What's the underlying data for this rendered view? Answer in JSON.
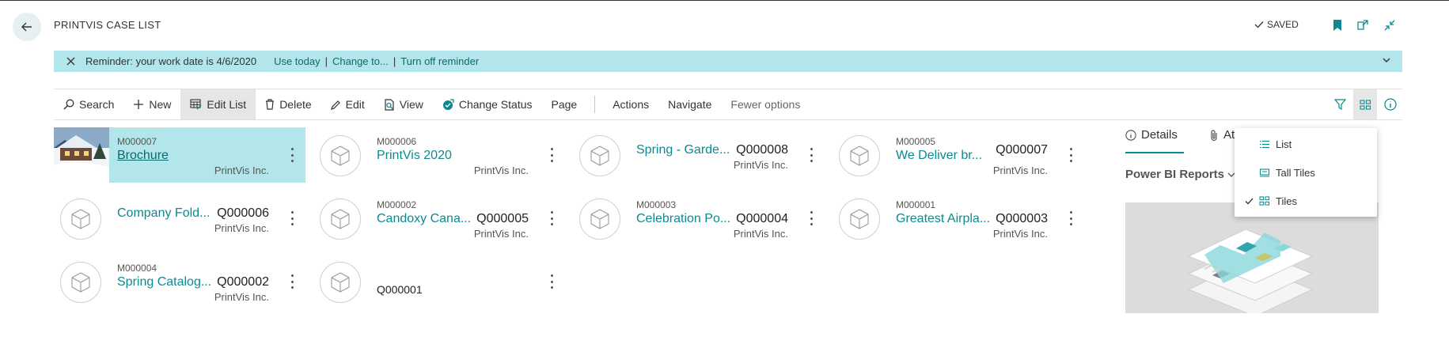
{
  "header": {
    "title": "PRINTVIS CASE LIST",
    "saved_label": "SAVED"
  },
  "reminder": {
    "message": "Reminder: your work date is 4/6/2020",
    "use_today": "Use today",
    "change_to": "Change to...",
    "turn_off": "Turn off reminder"
  },
  "actions": {
    "search": "Search",
    "new": "New",
    "edit_list": "Edit List",
    "delete": "Delete",
    "edit": "Edit",
    "view": "View",
    "change_status": "Change Status",
    "page": "Page",
    "actions": "Actions",
    "navigate": "Navigate",
    "fewer_options": "Fewer options"
  },
  "tiles": [
    {
      "code": "M000007",
      "name": "Brochure",
      "number": "",
      "company": "PrintVis Inc."
    },
    {
      "code": "M000006",
      "name": "PrintVis 2020",
      "number": "",
      "company": "PrintVis Inc."
    },
    {
      "code": "",
      "name": "Spring - Garde...",
      "number": "Q000008",
      "company": "PrintVis Inc."
    },
    {
      "code": "M000005",
      "name": "We Deliver br...",
      "number": "Q000007",
      "company": "PrintVis Inc."
    },
    {
      "code": "",
      "name": "Company Fold...",
      "number": "Q000006",
      "company": "PrintVis Inc."
    },
    {
      "code": "M000002",
      "name": "Candoxy Cana...",
      "number": "Q000005",
      "company": "PrintVis Inc."
    },
    {
      "code": "M000003",
      "name": "Celebration Po...",
      "number": "Q000004",
      "company": "PrintVis Inc."
    },
    {
      "code": "M000001",
      "name": "Greatest Airpla...",
      "number": "Q000003",
      "company": "PrintVis Inc."
    },
    {
      "code": "M000004",
      "name": "Spring Catalog...",
      "number": "Q000002",
      "company": "PrintVis Inc."
    },
    {
      "code": "",
      "name": "",
      "number": "Q000001",
      "company": ""
    }
  ],
  "pane": {
    "details_tab": "Details",
    "attachments_tab": "At",
    "powerbi_title": "Power BI Reports"
  },
  "view_menu": {
    "items": [
      {
        "label": "List",
        "checked": false
      },
      {
        "label": "Tall Tiles",
        "checked": false
      },
      {
        "label": "Tiles",
        "checked": true
      }
    ]
  },
  "colors": {
    "accent": "#0b8a8f",
    "highlight": "#b2e6ea"
  }
}
